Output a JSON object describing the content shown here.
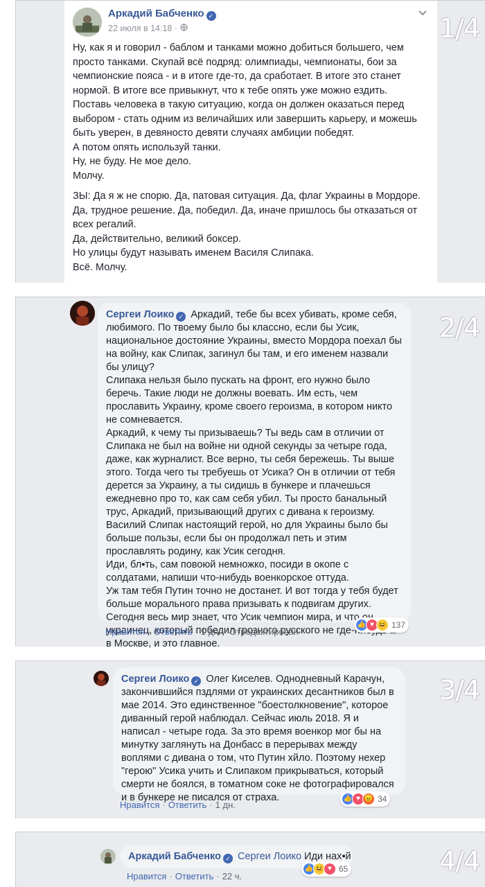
{
  "panels": [
    {
      "page_label": "1/4",
      "author": "Аркадий Бабченко",
      "timestamp": "22 июля в 14:18",
      "dot": "·",
      "privacy_icon": "globe-icon",
      "more_icon": "chevron-down-icon",
      "paragraphs": [
        "Ну, как я и говорил - баблом и танками можно добиться большего, чем просто танками. Скупай всё подряд: олимпиады, чемпионаты, бои за чемпионские пояса - и в итоге где-то, да сработает. В итоге это станет нормой. В итоге все привыкнут, что к тебе опять уже можно ездить.",
        "Поставь человека в такую ситуацию, когда он должен оказаться перед выбором - стать одним из величайших или завершить карьеру, и можешь быть уверен, в девяносто девяти случаях амбиции победят.",
        "А потом опять используй танки.",
        "Ну, не буду. Не мое дело.",
        "Молчу.",
        "ЗЫ: Да я ж не спорю. Да, патовая ситуация. Да, флаг Украины в Мордоре. Да, трудное решение. Да, победил. Да, иначе пришлось бы отказаться от всех регалий.",
        "Да, действительно, великий боксер.",
        "Но улицы будут называть именем Василя Слипака.",
        "Всё. Молчу."
      ]
    },
    {
      "page_label": "2/4",
      "author": "Сергеи Лоико",
      "lines": [
        "Аркадий, тебе бы всех убивать, кроме себя, любимого. По твоему было бы классно, если бы Усик, национальное достояние Украины, вместо Мордора поехал бы на войну, как Слипак, загинул бы там, и его именем назвали бы улицу?",
        "Слипака нельзя было пускать на фронт, его нужно было беречь. Такие люди не должны воевать. Им есть, чем прославить Украину, кроме своего героизма, в котором никто не сомневается.",
        "Аркадий, к чему ты призываешь? Ты ведь сам в отличии от Слипака не был на войне ни одной секунды за четыре года, даже, как журналист. Все верно, ты себя бережешь. Ты выше этого. Тогда чего ты требуешь от Усика? Он в отличии от тебя дерется за Украину, а ты сидишь в бункере и плачешься ежедневно про то, как сам себя убил. Ты просто банальный трус, Аркадий, призывающий других с дивана к героизму. Василий Слипак настоящий герой, но для Украины было бы больше пользы, если бы он продолжал петь и этим прославлять родину, как Усик сегодня.",
        "Иди, бл▪ть, сам повоюй немножко, посиди в окопе с солдатами, напиши что-нибудь военкорское оттуда.",
        "Уж там тебя Путин точно не достанет. И вот тогда у тебя будет больше морального права призывать к подвигам других.",
        "Сегодня весь мир знает, что Усик чемпион мира, и что он украинец, который победил грозного русского не где-нибудь а в Москве, и это главное."
      ],
      "actions": [
        "Нравится",
        "Ответить",
        "1 дн.",
        "Отредактирован"
      ],
      "reaction_count": "137"
    },
    {
      "page_label": "3/4",
      "author": "Сергеи Лоико",
      "text": "Олег Киселев. Однодневный Карачун, закончившийся пздлями от украинских десантников был в мае 2014. Это единственное \"боестолкновение\", которое диванный герой наблюдал. Сейчас июль 2018. Я и написал - четыре года. За это время военкор мог бы на минутку заглянуть на Донбасс в перерывах между воплями с дивана о том, что Путин хйло. Поэтому нехер \"герою\" Усика учить и Слипаком прикрываться, который смерти не боялся, в томатном соке не фотографировался и в бункере не писался от страха.",
      "actions": [
        "Нравится",
        "Ответить",
        "1 дн."
      ],
      "reaction_count": "34"
    },
    {
      "page_label": "4/4",
      "author": "Аркадий Бабченко",
      "mention": "Сергеи Лоико",
      "text": "Иди нах▪й",
      "actions": [
        "Нравится",
        "Ответить",
        "22 ч."
      ],
      "reaction_count": "65"
    }
  ],
  "colors": {
    "link": "#385898",
    "action": "#4267b2",
    "bubble": "#f2f3f5",
    "panel": "#e9ebee"
  }
}
